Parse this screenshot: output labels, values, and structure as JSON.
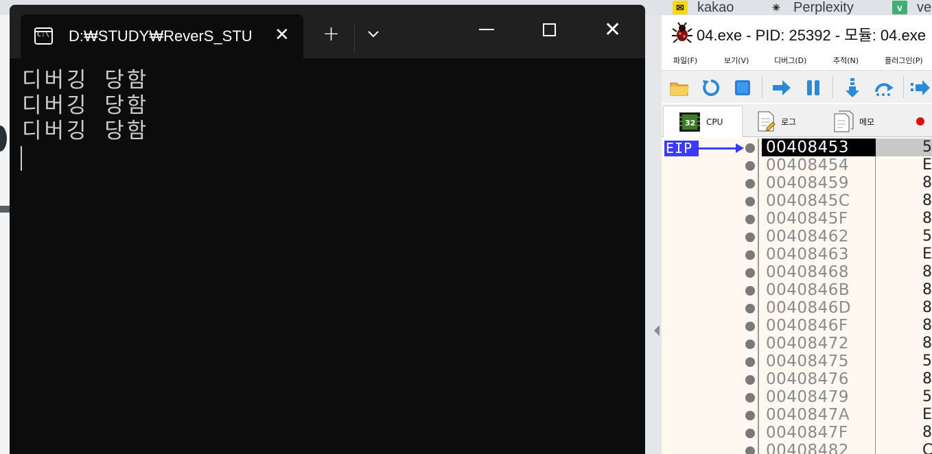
{
  "background_tabs": [
    {
      "icon": "mail-icon",
      "label": "kakao"
    },
    {
      "icon": "perplexity-icon",
      "label": "Perplexity"
    },
    {
      "icon": "v-icon",
      "label": "ve"
    }
  ],
  "terminal": {
    "tab_title": "D:₩STUDY₩ReverS_STU",
    "output_lines": [
      "디버깅 당함",
      "디버깅 당함",
      "디버깅 당함"
    ]
  },
  "debugger": {
    "title": "04.exe - PID: 25392 - 모듈: 04.exe",
    "menu": [
      "파일(F)",
      "보기(V)",
      "디버그(D)",
      "추적(N)",
      "플러그인(P)"
    ],
    "tabs": [
      {
        "label": "CPU",
        "icon": "cpu-icon"
      },
      {
        "label": "로그",
        "icon": "log-icon"
      },
      {
        "label": "메모",
        "icon": "notes-icon"
      },
      {
        "label": "",
        "icon": "breakpoint-icon"
      }
    ],
    "eip_label": "EIP",
    "rows": [
      {
        "addr": "00408453",
        "byte": "5"
      },
      {
        "addr": "00408454",
        "byte": "E"
      },
      {
        "addr": "00408459",
        "byte": "8"
      },
      {
        "addr": "0040845C",
        "byte": "8"
      },
      {
        "addr": "0040845F",
        "byte": "8"
      },
      {
        "addr": "00408462",
        "byte": "5"
      },
      {
        "addr": "00408463",
        "byte": "E"
      },
      {
        "addr": "00408468",
        "byte": "8"
      },
      {
        "addr": "0040846B",
        "byte": "8"
      },
      {
        "addr": "0040846D",
        "byte": "8"
      },
      {
        "addr": "0040846F",
        "byte": "8"
      },
      {
        "addr": "00408472",
        "byte": "8"
      },
      {
        "addr": "00408475",
        "byte": "5"
      },
      {
        "addr": "00408476",
        "byte": "8"
      },
      {
        "addr": "00408479",
        "byte": "5"
      },
      {
        "addr": "0040847A",
        "byte": "E"
      },
      {
        "addr": "0040847F",
        "byte": "8"
      },
      {
        "addr": "00408482",
        "byte": "C"
      }
    ]
  }
}
